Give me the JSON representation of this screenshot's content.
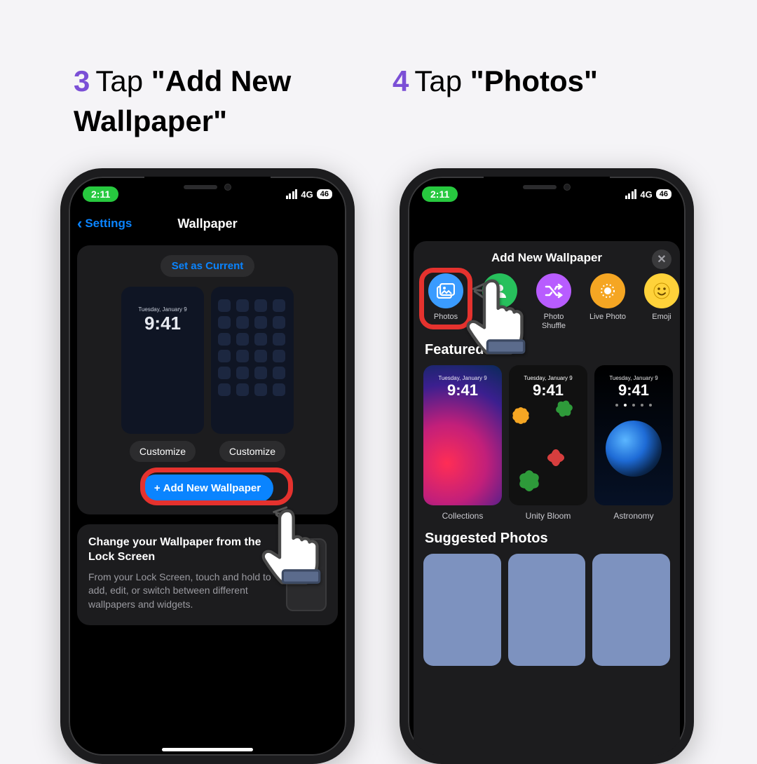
{
  "steps": {
    "s3": {
      "num": "3",
      "prefix": "Tap ",
      "bold": "\"Add New Wallpaper\""
    },
    "s4": {
      "num": "4",
      "prefix": "Tap ",
      "bold": "\"Photos\""
    }
  },
  "status": {
    "time": "2:11",
    "network": "4G",
    "battery": "46"
  },
  "phone1": {
    "back_label": "Settings",
    "title": "Wallpaper",
    "set_current": "Set as Current",
    "preview_date": "Tuesday, January 9",
    "preview_time": "9:41",
    "customize": "Customize",
    "add_new": "Add New Wallpaper",
    "tip_title": "Change your Wallpaper from the Lock Screen",
    "tip_body": "From your Lock Screen, touch and hold to add, edit, or switch between different wallpapers and widgets."
  },
  "phone2": {
    "sheet_title": "Add New Wallpaper",
    "categories": [
      {
        "label": "Photos"
      },
      {
        "label": "People"
      },
      {
        "label": "Photo Shuffle"
      },
      {
        "label": "Live Photo"
      },
      {
        "label": "Emoji"
      }
    ],
    "featured_heading": "Featured",
    "featured": [
      {
        "label": "Collections",
        "date": "Tuesday, January 9",
        "time": "9:41"
      },
      {
        "label": "Unity Bloom",
        "date": "Tuesday, January 9",
        "time": "9:41"
      },
      {
        "label": "Astronomy",
        "date": "Tuesday, January 9",
        "time": "9:41"
      }
    ],
    "suggested_heading": "Suggested Photos"
  }
}
